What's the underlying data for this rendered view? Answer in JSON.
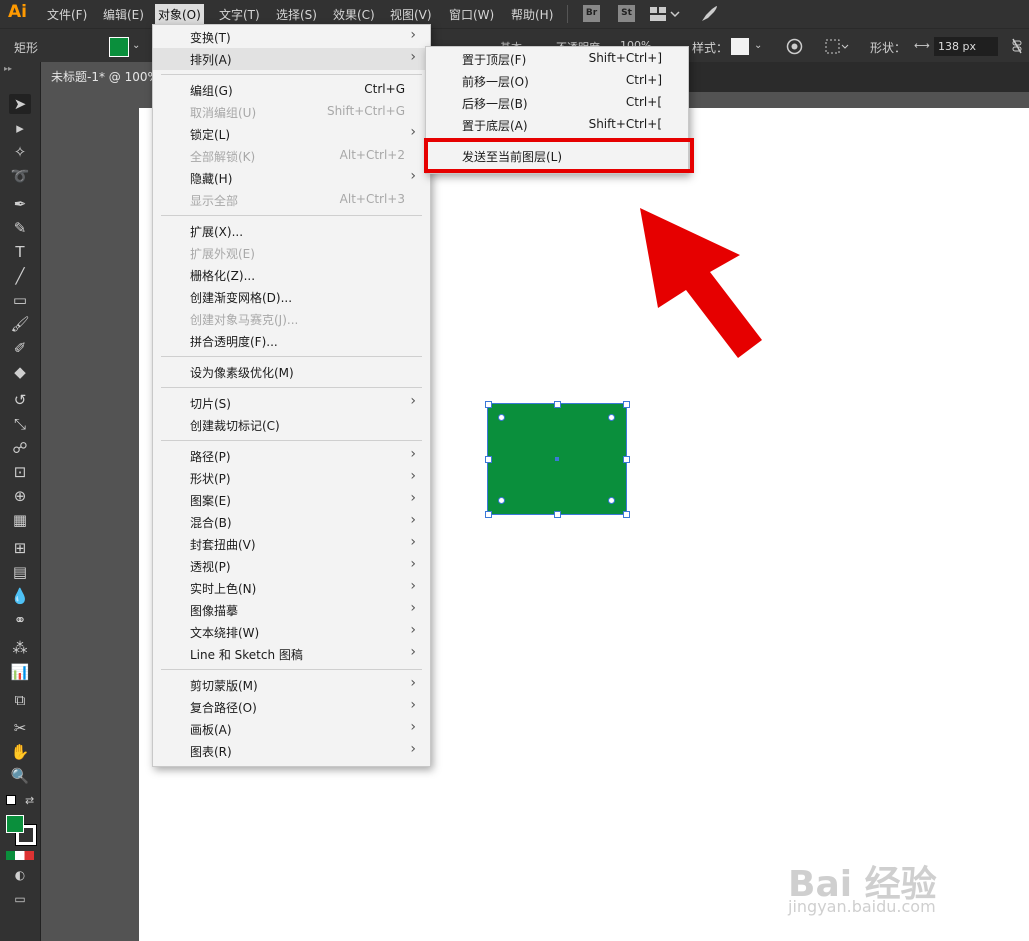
{
  "app": {
    "logo": "Ai",
    "brand_color": "#ff9a00"
  },
  "menubar": {
    "items": [
      "文件(F)",
      "编辑(E)",
      "对象(O)",
      "文字(T)",
      "选择(S)",
      "效果(C)",
      "视图(V)",
      "窗口(W)",
      "帮助(H)"
    ],
    "active_index": 2,
    "buttons": [
      "Br",
      "St"
    ]
  },
  "controlbar": {
    "tool_label": "矩形",
    "opacity_label": "不透明度",
    "opacity_value": "100%",
    "stroke_weight_label": "基本",
    "style_label": "样式：",
    "shape_label": "形状：",
    "width_value": "138 px"
  },
  "document": {
    "tab_title": "未标题-1* @ 100%"
  },
  "colors": {
    "fill": "#0a8f3c",
    "selection": "#3c78d8",
    "highlight_box": "#e60000"
  },
  "object_menu": {
    "groups": [
      [
        {
          "label": "变换(T)",
          "arrow": true
        },
        {
          "label": "排列(A)",
          "arrow": true,
          "highlighted": true
        }
      ],
      [
        {
          "label": "编组(G)",
          "shortcut": "Ctrl+G"
        },
        {
          "label": "取消编组(U)",
          "shortcut": "Shift+Ctrl+G",
          "disabled": true
        },
        {
          "label": "锁定(L)",
          "arrow": true
        },
        {
          "label": "全部解锁(K)",
          "shortcut": "Alt+Ctrl+2",
          "disabled": true
        },
        {
          "label": "隐藏(H)",
          "arrow": true
        },
        {
          "label": "显示全部",
          "shortcut": "Alt+Ctrl+3",
          "disabled": true
        }
      ],
      [
        {
          "label": "扩展(X)..."
        },
        {
          "label": "扩展外观(E)",
          "disabled": true
        },
        {
          "label": "栅格化(Z)..."
        },
        {
          "label": "创建渐变网格(D)..."
        },
        {
          "label": "创建对象马赛克(J)...",
          "disabled": true
        },
        {
          "label": "拼合透明度(F)..."
        }
      ],
      [
        {
          "label": "设为像素级优化(M)"
        }
      ],
      [
        {
          "label": "切片(S)",
          "arrow": true
        },
        {
          "label": "创建裁切标记(C)"
        }
      ],
      [
        {
          "label": "路径(P)",
          "arrow": true
        },
        {
          "label": "形状(P)",
          "arrow": true
        },
        {
          "label": "图案(E)",
          "arrow": true
        },
        {
          "label": "混合(B)",
          "arrow": true
        },
        {
          "label": "封套扭曲(V)",
          "arrow": true
        },
        {
          "label": "透视(P)",
          "arrow": true
        },
        {
          "label": "实时上色(N)",
          "arrow": true
        },
        {
          "label": "图像描摹",
          "arrow": true
        },
        {
          "label": "文本绕排(W)",
          "arrow": true
        },
        {
          "label": "Line 和 Sketch 图稿",
          "arrow": true
        }
      ],
      [
        {
          "label": "剪切蒙版(M)",
          "arrow": true
        },
        {
          "label": "复合路径(O)",
          "arrow": true
        },
        {
          "label": "画板(A)",
          "arrow": true
        },
        {
          "label": "图表(R)",
          "arrow": true
        }
      ]
    ]
  },
  "arrange_submenu": {
    "groups": [
      [
        {
          "label": "置于顶层(F)",
          "shortcut": "Shift+Ctrl+]"
        },
        {
          "label": "前移一层(O)",
          "shortcut": "Ctrl+]"
        },
        {
          "label": "后移一层(B)",
          "shortcut": "Ctrl+["
        },
        {
          "label": "置于底层(A)",
          "shortcut": "Shift+Ctrl+["
        }
      ],
      [
        {
          "label": "发送至当前图层(L)"
        }
      ]
    ]
  },
  "watermark": {
    "brand": "Bai 经验",
    "url": "jingyan.baidu.com"
  }
}
